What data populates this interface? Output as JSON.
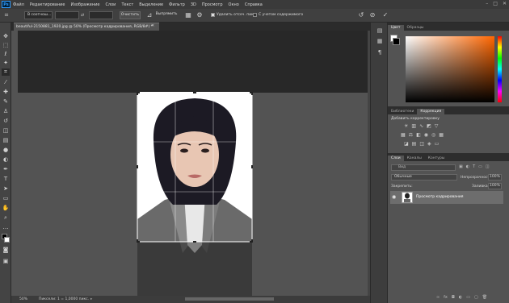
{
  "app": {
    "logo": "Ps"
  },
  "menu": [
    "Файл",
    "Редактирование",
    "Изображение",
    "Слои",
    "Текст",
    "Выделение",
    "Фильтр",
    "3D",
    "Просмотр",
    "Окно",
    "Справка"
  ],
  "options": {
    "ratio_select": "В соотнош...",
    "clear_label": "Очистить",
    "straighten_label": "Выпрямить",
    "delete_cropped_label": "Удалить отсеч. пикс.",
    "content_aware_label": "С учетом содержимого"
  },
  "document": {
    "tab_title": "beautiful-2150881_1920.jpg @ 50% (Просмотр кадрирования, RGB/8#) *",
    "zoom": "50%",
    "status_info": "Пиксели: 1 = 1,0000 пикс."
  },
  "panels": {
    "color_tabs": [
      "Цвет",
      "Образцы"
    ],
    "adjust_tabs": [
      "Библиотеки",
      "Коррекция"
    ],
    "adjust_add": "Добавить корректировку",
    "layers_tabs": [
      "Слои",
      "Каналы",
      "Контуры"
    ],
    "filter_placeholder": "Вид",
    "blend_mode": "Обычные",
    "opacity_label": "Непрозрачность:",
    "opacity_value": "100%",
    "lock_label": "Закрепить:",
    "fill_label": "Заливка:",
    "fill_value": "100%",
    "layer_name": "Просмотр кадрирования"
  },
  "colors": {
    "accent": "#2f9bff",
    "panel": "#535353",
    "dark": "#282828"
  }
}
